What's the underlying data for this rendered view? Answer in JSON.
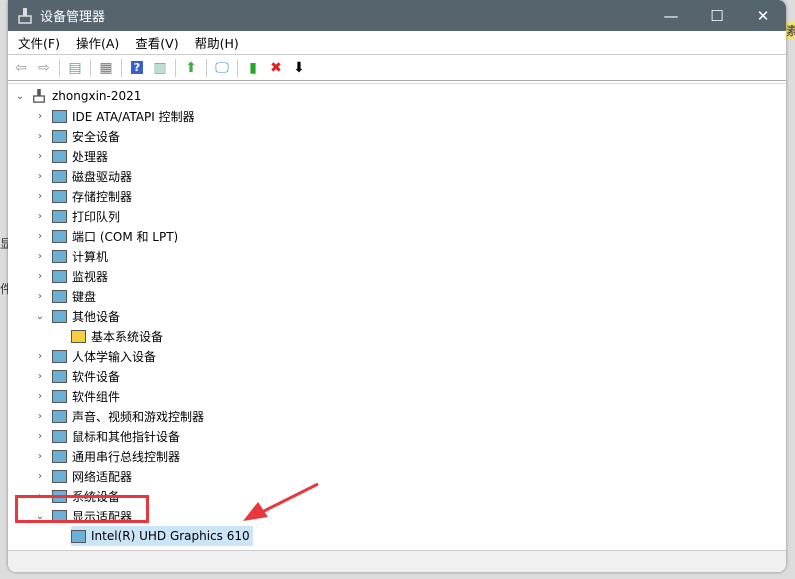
{
  "window": {
    "title": "设备管理器",
    "minimize": "—",
    "maximize": "☐",
    "close": "✕"
  },
  "menu": [
    "文件(F)",
    "操作(A)",
    "查看(V)",
    "帮助(H)"
  ],
  "toolbar": [
    "back-icon",
    "forward-icon",
    "show-hide-console-tree-icon",
    "properties-icon",
    "help-icon",
    "action-pane-icon",
    "update-driver-icon",
    "scan-hardware-icon",
    "enable-device-icon",
    "uninstall-device-icon",
    "disable-device-icon"
  ],
  "tree": {
    "root": "zhongxin-2021",
    "items": [
      {
        "label": "IDE ATA/ATAPI 控制器",
        "expanded": false
      },
      {
        "label": "安全设备",
        "expanded": false
      },
      {
        "label": "处理器",
        "expanded": false
      },
      {
        "label": "磁盘驱动器",
        "expanded": false
      },
      {
        "label": "存储控制器",
        "expanded": false
      },
      {
        "label": "打印队列",
        "expanded": false
      },
      {
        "label": "端口 (COM 和 LPT)",
        "expanded": false
      },
      {
        "label": "计算机",
        "expanded": false
      },
      {
        "label": "监视器",
        "expanded": false
      },
      {
        "label": "键盘",
        "expanded": false
      },
      {
        "label": "其他设备",
        "expanded": true
      },
      {
        "label": "基本系统设备",
        "child": true,
        "warning": true
      },
      {
        "label": "人体学输入设备",
        "expanded": false
      },
      {
        "label": "软件设备",
        "expanded": false
      },
      {
        "label": "软件组件",
        "expanded": false
      },
      {
        "label": "声音、视频和游戏控制器",
        "expanded": false
      },
      {
        "label": "鼠标和其他指针设备",
        "expanded": false
      },
      {
        "label": "通用串行总线控制器",
        "expanded": false
      },
      {
        "label": "网络适配器",
        "expanded": false
      },
      {
        "label": "系统设备",
        "expanded": false
      },
      {
        "label": "显示适配器",
        "expanded": true,
        "highlighted": true
      },
      {
        "label": "Intel(R) UHD Graphics 610",
        "child": true,
        "selected": true
      }
    ]
  },
  "background": {
    "left_chars": [
      "显",
      "件"
    ],
    "right_char": "素"
  },
  "colors": {
    "titlebar": "#56646e",
    "annotation": "#e8373d",
    "selection": "#cce4f7"
  }
}
